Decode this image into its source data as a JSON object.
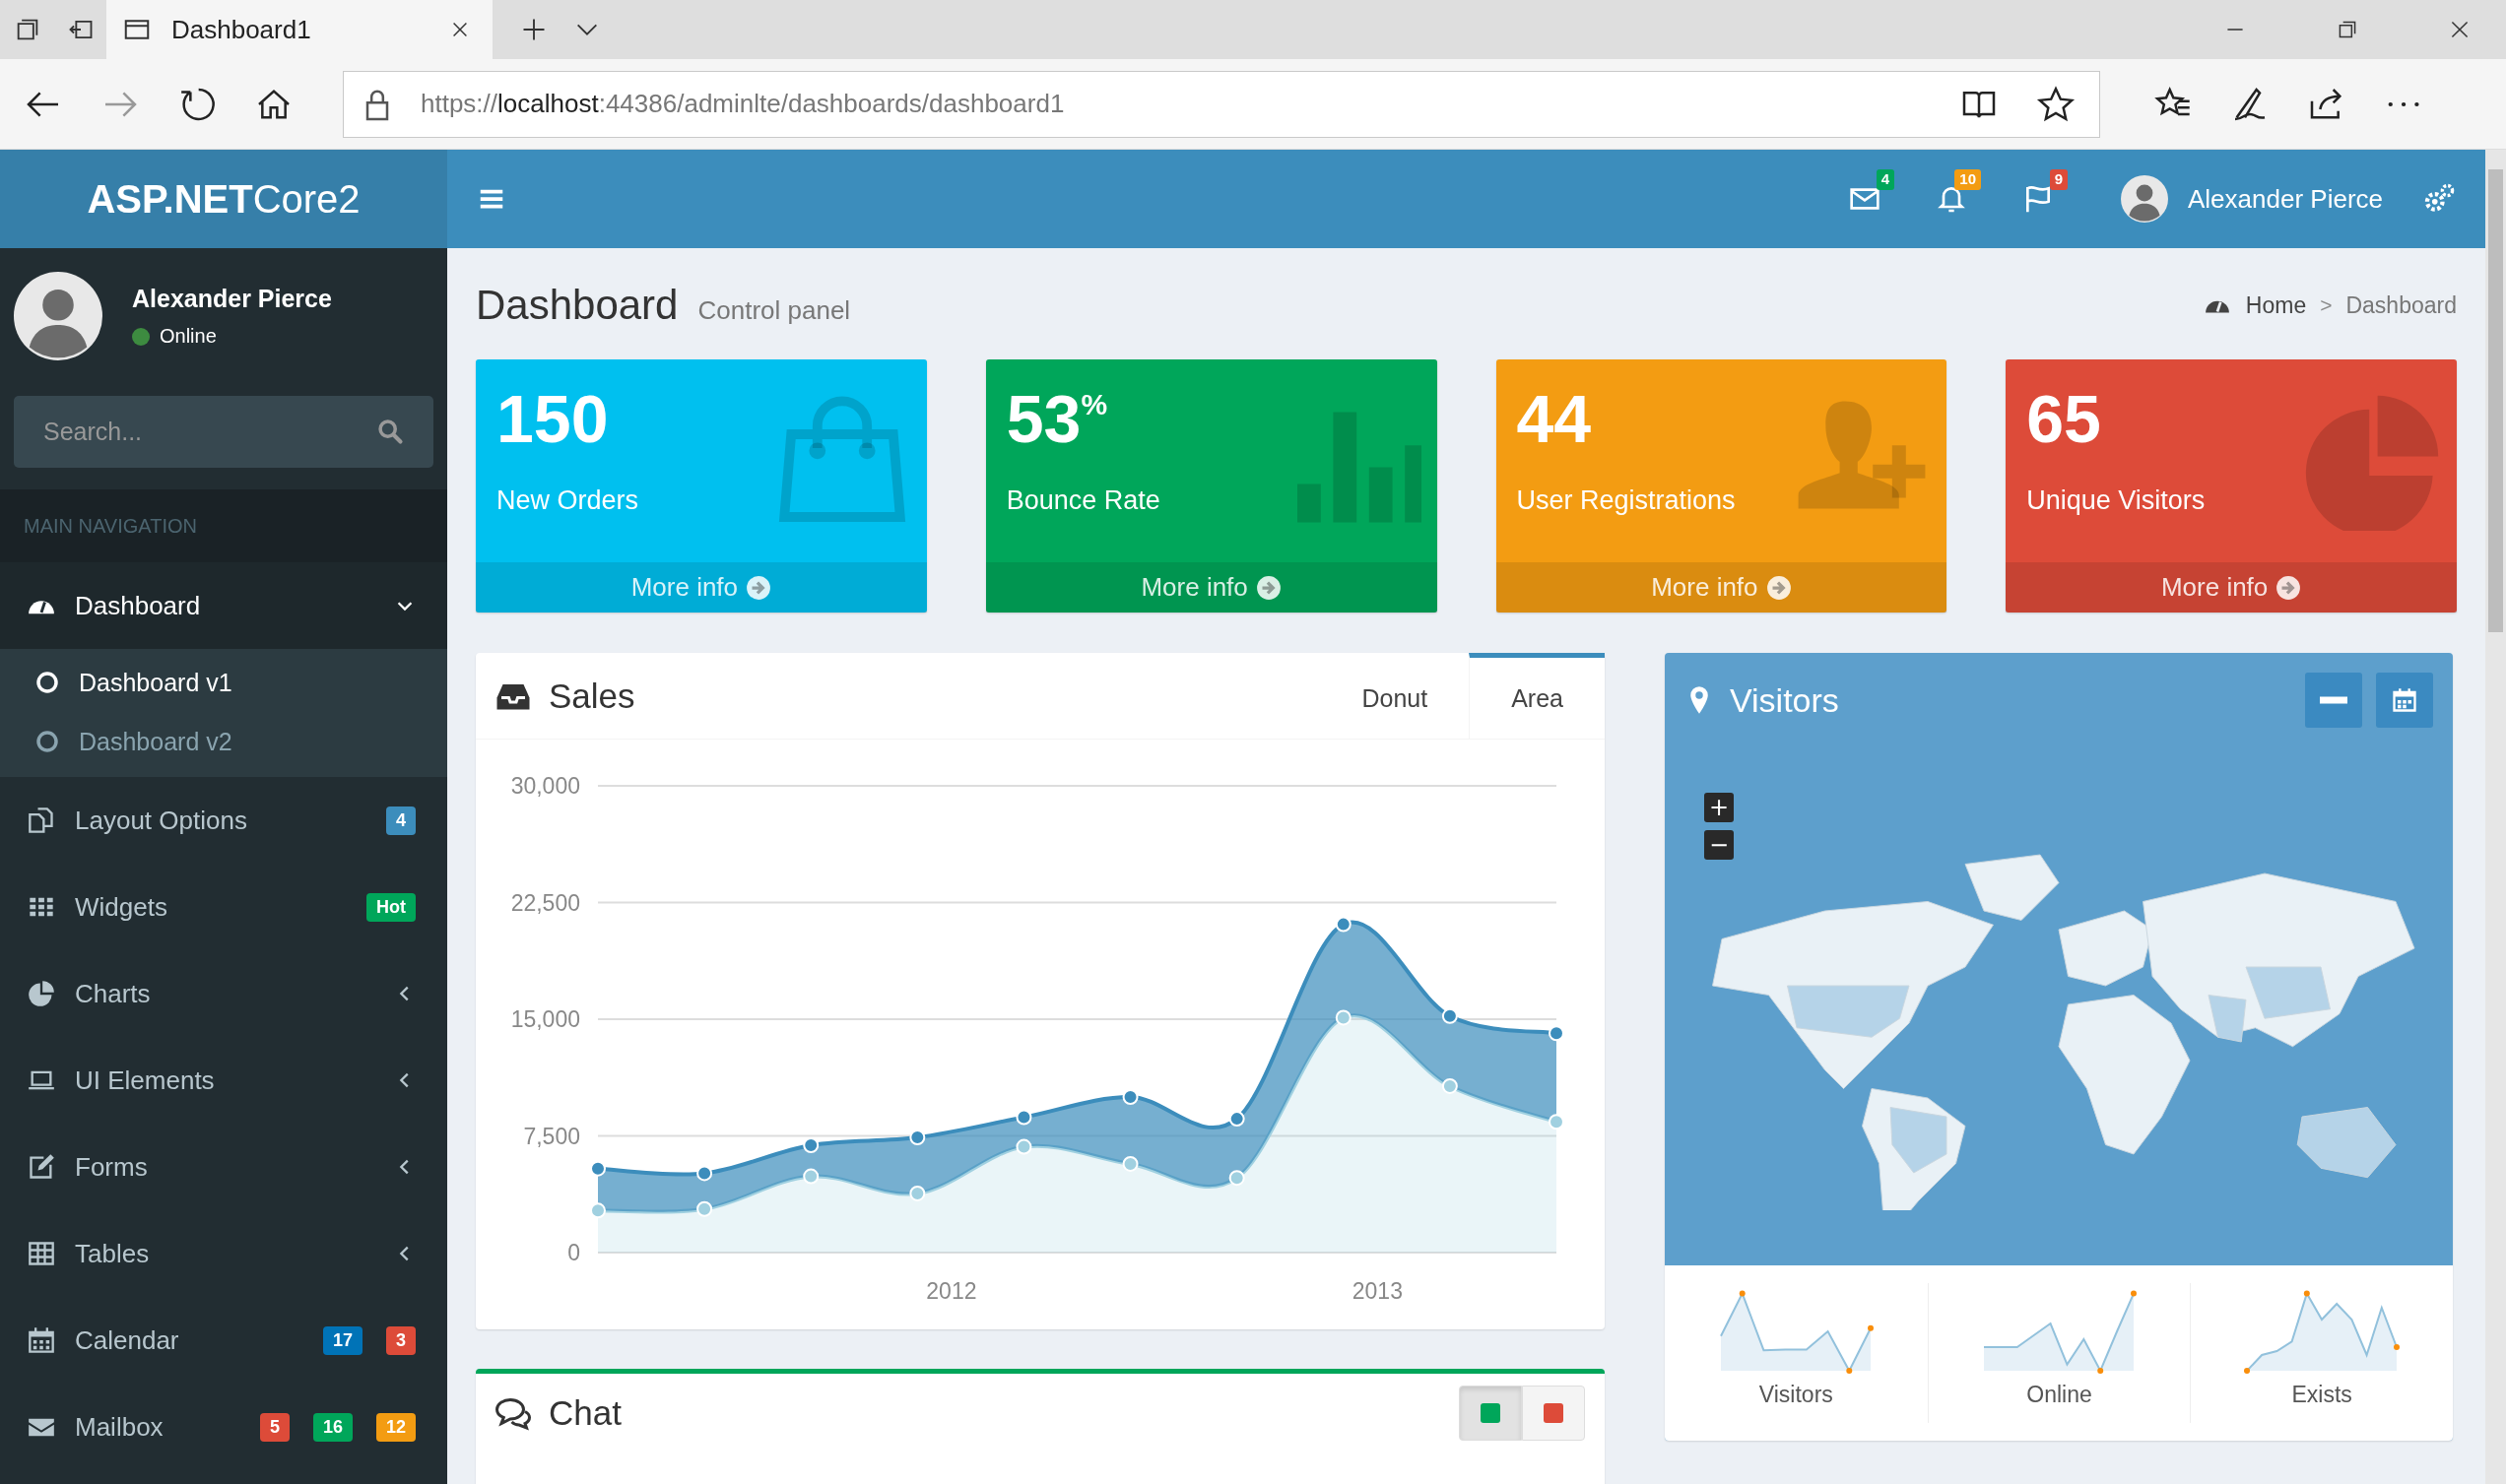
{
  "browser": {
    "tabs": [
      {
        "title": "Dashboard1",
        "selected": true
      }
    ],
    "url": {
      "scheme": "https://",
      "host": "localhost",
      "path": ":44386/adminlte/dashboards/dashboard1"
    }
  },
  "header": {
    "brand": {
      "strong": "ASP.NET",
      "light": "Core2"
    },
    "notifications": [
      {
        "count": "4",
        "color": "#00a65a"
      },
      {
        "count": "10",
        "color": "#f39c12"
      },
      {
        "count": "9",
        "color": "#dd4b39"
      }
    ],
    "user": "Alexander Pierce"
  },
  "sidebar": {
    "user": {
      "name": "Alexander Pierce",
      "status": "Online"
    },
    "search": {
      "placeholder": "Search..."
    },
    "section": "MAIN NAVIGATION",
    "items": [
      {
        "label": "Dashboard",
        "selected": true,
        "expanded": true,
        "children": [
          {
            "label": "Dashboard v1",
            "selected": true
          },
          {
            "label": "Dashboard v2",
            "selected": false
          }
        ]
      },
      {
        "label": "Layout Options",
        "selected": false,
        "badges": [
          {
            "text": "4",
            "color": "#3c8dbc"
          }
        ]
      },
      {
        "label": "Widgets",
        "selected": false,
        "badges": [
          {
            "text": "Hot",
            "color": "#00a65a"
          }
        ]
      },
      {
        "label": "Charts",
        "selected": false,
        "expanded": false
      },
      {
        "label": "UI Elements",
        "selected": false,
        "expanded": false
      },
      {
        "label": "Forms",
        "selected": false,
        "expanded": false
      },
      {
        "label": "Tables",
        "selected": false,
        "expanded": false
      },
      {
        "label": "Calendar",
        "selected": false,
        "badges": [
          {
            "text": "17",
            "color": "#0073b7"
          },
          {
            "text": "3",
            "color": "#dd4b39"
          }
        ]
      },
      {
        "label": "Mailbox",
        "selected": false,
        "badges": [
          {
            "text": "5",
            "color": "#dd4b39"
          },
          {
            "text": "16",
            "color": "#00a65a"
          },
          {
            "text": "12",
            "color": "#f39c12"
          }
        ]
      }
    ]
  },
  "page": {
    "title": "Dashboard",
    "subtitle": "Control panel",
    "breadcrumb": {
      "separator": ">",
      "items": [
        "Home",
        "Dashboard"
      ]
    }
  },
  "info_boxes": [
    {
      "value": "150",
      "label": "New Orders",
      "link": "More info",
      "color": "#00c0ef"
    },
    {
      "value": "53",
      "unit": "%",
      "label": "Bounce Rate",
      "link": "More info",
      "color": "#00a65a"
    },
    {
      "value": "44",
      "label": "User Registrations",
      "link": "More info",
      "color": "#f39c12"
    },
    {
      "value": "65",
      "label": "Unique Visitors",
      "link": "More info",
      "color": "#dd4b39"
    }
  ],
  "sales": {
    "title": "Sales",
    "tabs": [
      {
        "label": "Donut",
        "selected": false
      },
      {
        "label": "Area",
        "selected": true
      }
    ],
    "chart_data": {
      "type": "area",
      "stacked": true,
      "grid": true,
      "x": [
        2011.17,
        2011.42,
        2011.67,
        2011.92,
        2012.17,
        2012.42,
        2012.67,
        2012.92,
        2013.17,
        2013.42
      ],
      "xlim": [
        2011.17,
        2013.42
      ],
      "ylim": [
        0,
        30000
      ],
      "xticks": [
        2012,
        2013
      ],
      "yticks": [
        {
          "value": 0,
          "label": "0"
        },
        {
          "value": 7500,
          "label": "7,500"
        },
        {
          "value": 15000,
          "label": "15,000"
        },
        {
          "value": 22500,
          "label": "22,500"
        },
        {
          "value": 30000,
          "label": "30,000"
        }
      ],
      "series": [
        {
          "color": "#a0d0e0",
          "values": [
            2700,
            2800,
            4900,
            3800,
            6800,
            5700,
            4800,
            15100,
            10700,
            8400
          ]
        },
        {
          "color": "#3c8dbc",
          "values": [
            2700,
            2300,
            2000,
            3600,
            1900,
            4300,
            3800,
            6000,
            4500,
            5700
          ]
        }
      ]
    }
  },
  "visitors": {
    "title": "Visitors",
    "map_zoom": [
      "+",
      "−"
    ],
    "sparklines": [
      "Visitors",
      "Online",
      "Exists"
    ]
  },
  "chat": {
    "title": "Chat",
    "toggles": [
      {
        "color": "#00a65a",
        "selected": true
      },
      {
        "color": "#dd4b39",
        "selected": false
      }
    ]
  }
}
